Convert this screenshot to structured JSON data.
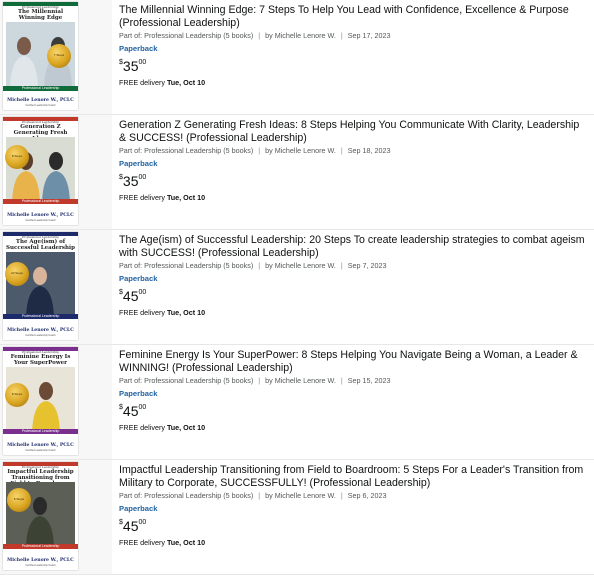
{
  "results": [
    {
      "title": "The Millennial Winning Edge: 7 Steps To Help You Lead with Confidence, Excellence & Purpose (Professional Leadership)",
      "series": "Part of: Professional Leadership (5 books)",
      "author": "by Michelle Lenore W.",
      "date": "Sep 17, 2023",
      "format": "Paperback",
      "price_symbol": "$",
      "price_whole": "35",
      "price_fraction": "00",
      "delivery_label": "FREE delivery",
      "delivery_date": "Tue, Oct 10",
      "cover": {
        "series_tag": "Professional Leadership",
        "title": "The Millennial Winning Edge",
        "badge": "7 Steps",
        "bar_label": "Professional Leadership",
        "author": "Michelle Lenore W., PCLC",
        "author_sub": "Certified Leadership Coach",
        "accent": "#0f6b3a",
        "photo_bg": "#cdd8de"
      }
    },
    {
      "title": "Generation Z Generating Fresh Ideas: 8 Steps Helping You Communicate With Clarity, Leadership & SUCCESS! (Professional Leadership)",
      "series": "Part of: Professional Leadership (5 books)",
      "author": "by Michelle Lenore W.",
      "date": "Sep 18, 2023",
      "format": "Paperback",
      "price_symbol": "$",
      "price_whole": "35",
      "price_fraction": "00",
      "delivery_label": "FREE delivery",
      "delivery_date": "Tue, Oct 10",
      "cover": {
        "series_tag": "Professional Leadership",
        "title": "Generation Z Generating Fresh Ideas",
        "badge": "8 Steps",
        "bar_label": "Professional Leadership",
        "author": "Michelle Lenore W., PCLC",
        "author_sub": "Certified Leadership Coach",
        "accent": "#c0392b",
        "photo_bg": "#d9dcd2"
      }
    },
    {
      "title": "The Age(ism) of Successful Leadership: 20 Steps To create leadership strategies to combat ageism with SUCCESS! (Professional Leadership)",
      "series": "Part of: Professional Leadership (5 books)",
      "author": "by Michelle Lenore W.",
      "date": "Sep 7, 2023",
      "format": "Paperback",
      "price_symbol": "$",
      "price_whole": "45",
      "price_fraction": "00",
      "delivery_label": "FREE delivery",
      "delivery_date": "Tue, Oct 10",
      "cover": {
        "series_tag": "Professional Leadership",
        "title": "The Age(ism) of Successful Leadership",
        "badge": "20 Steps",
        "bar_label": "Professional Leadership",
        "author": "Michelle Lenore W., PCLC",
        "author_sub": "Certified Leadership Coach",
        "accent": "#1d2b6b",
        "photo_bg": "#4c5a6b"
      }
    },
    {
      "title": "Feminine Energy Is Your SuperPower: 8 Steps Helping You Navigate Being a Woman, a Leader & WINNING! (Professional Leadership)",
      "series": "Part of: Professional Leadership (5 books)",
      "author": "by Michelle Lenore W.",
      "date": "Sep 15, 2023",
      "format": "Paperback",
      "price_symbol": "$",
      "price_whole": "45",
      "price_fraction": "00",
      "delivery_label": "FREE delivery",
      "delivery_date": "Tue, Oct 10",
      "cover": {
        "series_tag": "Professional Leadership",
        "title": "Feminine Energy Is Your SuperPower",
        "badge": "8 Steps",
        "bar_label": "Professional Leadership",
        "author": "Michelle Lenore W., PCLC",
        "author_sub": "Certified Leadership Coach",
        "accent": "#7a2f8f",
        "photo_bg": "#e9e4d8"
      }
    },
    {
      "title": "Impactful Leadership Transitioning from Field to Boardroom: 5 Steps For a Leader's Transition from Military to Corporate, SUCCESSFULLY! (Professional Leadership)",
      "series": "Part of: Professional Leadership (5 books)",
      "author": "by Michelle Lenore W.",
      "date": "Sep 6, 2023",
      "format": "Paperback",
      "price_symbol": "$",
      "price_whole": "45",
      "price_fraction": "00",
      "delivery_label": "FREE delivery",
      "delivery_date": "Tue, Oct 10",
      "cover": {
        "series_tag": "Professional Leadership",
        "title": "Impactful Leadership Transitioning from Field to Boardroom",
        "badge": "5 Steps",
        "bar_label": "Professional Leadership",
        "author": "Michelle Lenore W., PCLC",
        "author_sub": "Certified Leadership Coach",
        "accent": "#c0392b",
        "photo_bg": "#5b5f55"
      }
    }
  ]
}
